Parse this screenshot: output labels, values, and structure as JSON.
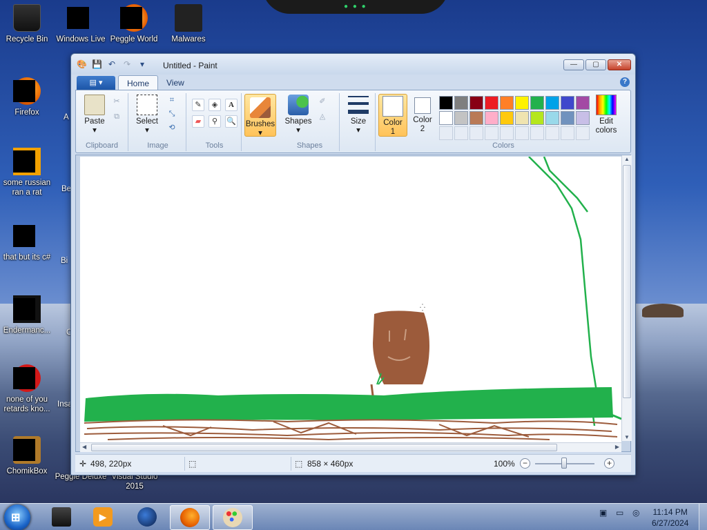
{
  "desktop": {
    "icons": [
      {
        "label": "Recycle Bin",
        "icon": "recycle-bin-icon"
      },
      {
        "label": "Windows Live",
        "icon": "windows-live-icon"
      },
      {
        "label": "Peggle World",
        "icon": "peggle-icon"
      },
      {
        "label": "Malwares",
        "icon": "folder-icon"
      },
      {
        "label": "Firefox",
        "icon": "firefox-icon"
      },
      {
        "label": "some russian ran a rat",
        "icon": "app-icon"
      },
      {
        "label": "that but its c#",
        "icon": "copy-icon"
      },
      {
        "label": "Endermanc...",
        "icon": "app-icon"
      },
      {
        "label": "none of you retards kno...",
        "icon": "opera-icon"
      },
      {
        "label": "ChomikBox",
        "icon": "chomikbox-icon"
      },
      {
        "label": "Peggle Deluxe",
        "icon": "peggle-icon"
      },
      {
        "label": "Visual Studio 2015",
        "icon": "visual-studio-icon"
      }
    ],
    "partial_labels": [
      "A",
      "Be",
      "Bi",
      "C",
      "Insa"
    ]
  },
  "window": {
    "title": "Untitled - Paint",
    "controls": {
      "minimize": "—",
      "maximize": "▢",
      "close": "✕"
    }
  },
  "ribbon": {
    "file_tab": "▤ ▾",
    "tabs": [
      "Home",
      "View"
    ],
    "active_tab": "Home",
    "help": "?",
    "groups": {
      "clipboard": {
        "label": "Clipboard",
        "paste": "Paste"
      },
      "image": {
        "label": "Image",
        "select": "Select"
      },
      "tools": {
        "label": "Tools",
        "text_tool": "A"
      },
      "brushes": {
        "label": "Brushes"
      },
      "shapes": {
        "label": "Shapes",
        "button": "Shapes"
      },
      "size": {
        "label": "Size"
      },
      "colors": {
        "label": "Colors",
        "color1_label": "Color",
        "color1_num": "1",
        "color2_label": "Color",
        "color2_num": "2",
        "edit_colors": "Edit colors",
        "palette_row1": [
          "#000000",
          "#7f7f7f",
          "#880015",
          "#ed1c24",
          "#ff7f27",
          "#fff200",
          "#22b14c",
          "#00a2e8",
          "#3f48cc",
          "#a349a4"
        ],
        "palette_row2": [
          "#ffffff",
          "#c3c3c3",
          "#b97a57",
          "#ffaec9",
          "#ffc90e",
          "#efe4b0",
          "#b5e61d",
          "#99d9ea",
          "#7092be",
          "#c8bfe7"
        ]
      }
    }
  },
  "status": {
    "cursor_pos": "498, 220px",
    "canvas_size": "858 × 460px",
    "zoom": "100%",
    "zoom_out": "−",
    "zoom_in": "+"
  },
  "taskbar": {
    "start": "⊞",
    "time": "11:14 PM",
    "date": "6/27/2024"
  },
  "colors": {
    "brown": "#9c5b3b",
    "green": "#22b14c",
    "ribbon_accent": "#ffc35a"
  }
}
